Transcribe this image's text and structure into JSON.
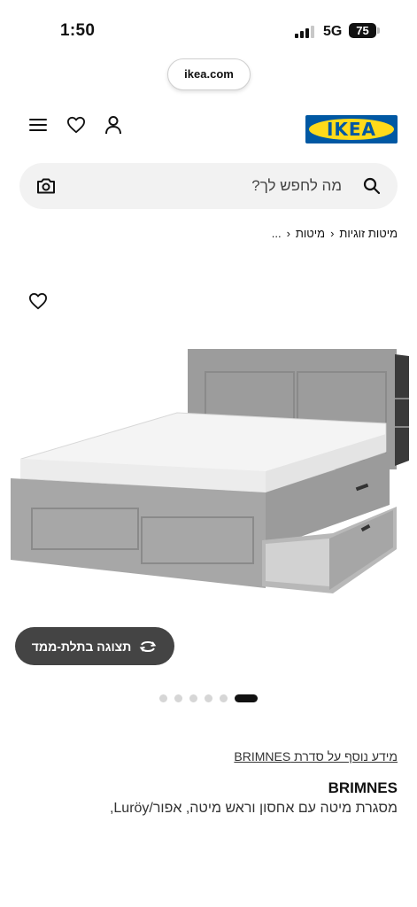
{
  "status_bar": {
    "time": "1:50",
    "network": "5G",
    "battery": "75"
  },
  "browser": {
    "url": "ikea.com"
  },
  "header": {
    "logo_text": "IKEA",
    "icons": [
      "menu-icon",
      "heart-icon",
      "user-icon"
    ]
  },
  "search": {
    "placeholder": "מה לחפש לך?"
  },
  "breadcrumb": {
    "items": [
      "...",
      "מיטות",
      "מיטות זוגיות"
    ]
  },
  "gallery": {
    "viewer_button_label": "תצוגה בתלת-ממד",
    "dot_count": 6,
    "active_index": 5
  },
  "product": {
    "series_link": "מידע נוסף על סדרת BRIMNES",
    "name": "BRIMNES",
    "description": "מסגרת מיטה עם אחסון וראש מיטה, אפור/Luröy,"
  },
  "colors": {
    "ikea_blue": "#0058a3",
    "ikea_yellow": "#ffda1a",
    "button_dark": "#444444"
  }
}
